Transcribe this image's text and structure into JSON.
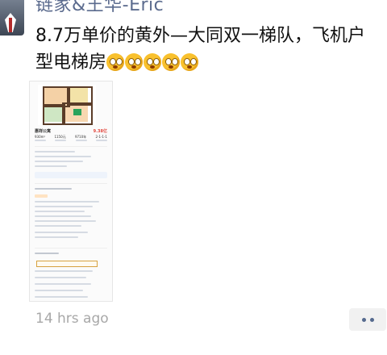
{
  "post": {
    "author": "链家&王华-Eric",
    "text": "8.7万单价的黄外—大同双一梯队，飞机户型电梯房",
    "emoji_count": 5,
    "emoji_name": "flushed-face-emoji",
    "timestamp": "14 hrs ago"
  },
  "thumbnail": {
    "title": "惠祥公寓",
    "price": "9.38亿",
    "stats": [
      "930m²",
      "1150元",
      "9710年",
      "2-1-1-1"
    ]
  },
  "colors": {
    "author": "#5b6b8e",
    "timestamp": "#a8a8a8",
    "more_dots": "#556a8e"
  }
}
